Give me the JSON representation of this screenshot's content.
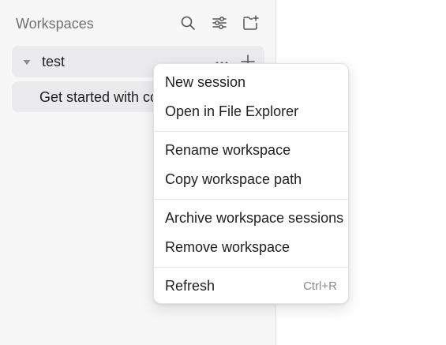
{
  "sidebar": {
    "title": "Workspaces",
    "header_icons": [
      "search-icon",
      "filter-settings-icon",
      "new-workspace-icon"
    ],
    "workspace": {
      "name": "test",
      "expanded": true
    },
    "session": {
      "label": "Get started with co"
    }
  },
  "context_menu": {
    "groups": [
      [
        {
          "label": "New session",
          "shortcut": ""
        },
        {
          "label": "Open in File Explorer",
          "shortcut": ""
        }
      ],
      [
        {
          "label": "Rename workspace",
          "shortcut": ""
        },
        {
          "label": "Copy workspace path",
          "shortcut": ""
        }
      ],
      [
        {
          "label": "Archive workspace sessions",
          "shortcut": ""
        },
        {
          "label": "Remove workspace",
          "shortcut": ""
        }
      ],
      [
        {
          "label": "Refresh",
          "shortcut": "Ctrl+R"
        }
      ]
    ]
  },
  "colors": {
    "sidebar_bg": "#f7f7f8",
    "row_bg": "#ebebee",
    "muted_text": "#6f6f74",
    "text": "#1f1f1f",
    "menu_bg": "#ffffff"
  }
}
